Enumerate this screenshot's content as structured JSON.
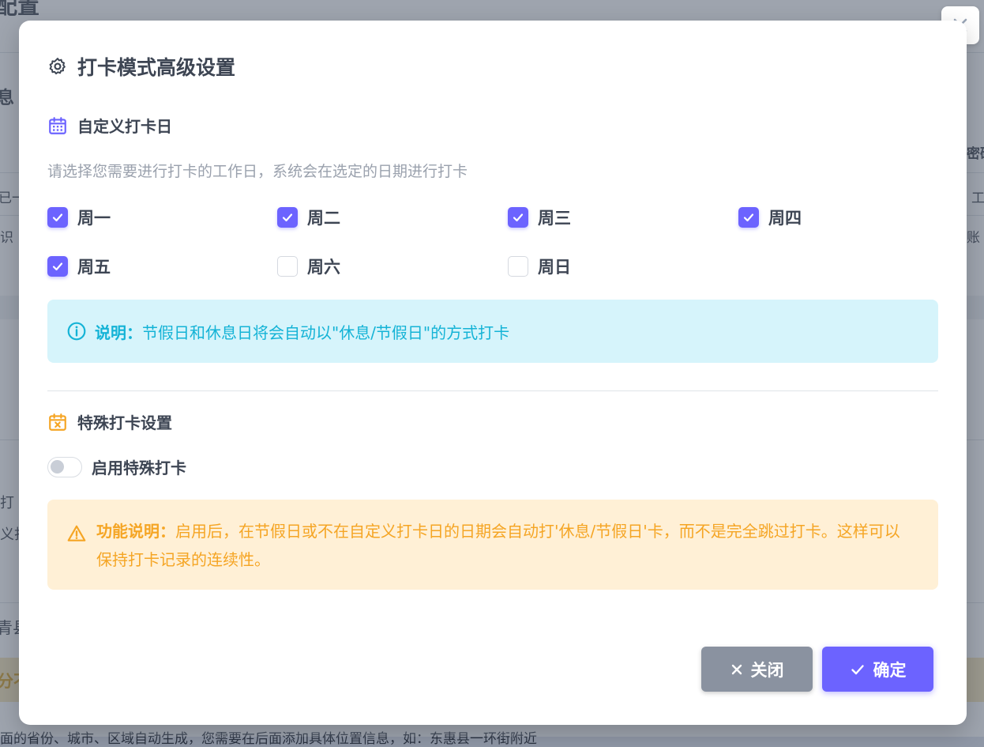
{
  "background": {
    "fragments": [
      "配置",
      "息",
      "密码",
      "工",
      "已一",
      "识",
      "账",
      "打",
      "义打",
      "青县",
      "分不",
      "面的省份、城市、区域自动生成，您需要在后面添加具体位置信息，如：东惠县一环街附近"
    ]
  },
  "modal": {
    "title": "打卡模式高级设置",
    "title_icon": "gear-icon",
    "custom_days": {
      "heading": "自定义打卡日",
      "icon": "calendar-icon",
      "hint": "请选择您需要进行打卡的工作日，系统会在选定的日期进行打卡",
      "days": [
        {
          "label": "周一",
          "checked": true
        },
        {
          "label": "周二",
          "checked": true
        },
        {
          "label": "周三",
          "checked": true
        },
        {
          "label": "周四",
          "checked": true
        },
        {
          "label": "周五",
          "checked": true
        },
        {
          "label": "周六",
          "checked": false
        },
        {
          "label": "周日",
          "checked": false
        }
      ],
      "info_label": "说明：",
      "info_text": "节假日和休息日将会自动以\"休息/节假日\"的方式打卡"
    },
    "special": {
      "heading": "特殊打卡设置",
      "icon": "calendar-x-icon",
      "toggle_label": "启用特殊打卡",
      "toggle_on": false,
      "warn_label": "功能说明：",
      "warn_text": "启用后，在节假日或不在自定义打卡日的日期会自动打'休息/节假日'卡，而不是完全跳过打卡。这样可以保持打卡记录的连续性。"
    },
    "buttons": {
      "close_label": "关闭",
      "ok_label": "确定"
    }
  },
  "colors": {
    "accent": "#6c63ff",
    "info_text": "#14b3d6",
    "info_bg": "#d6f4fb",
    "warn_text": "#f5a524",
    "warn_bg": "#fff0d6"
  }
}
